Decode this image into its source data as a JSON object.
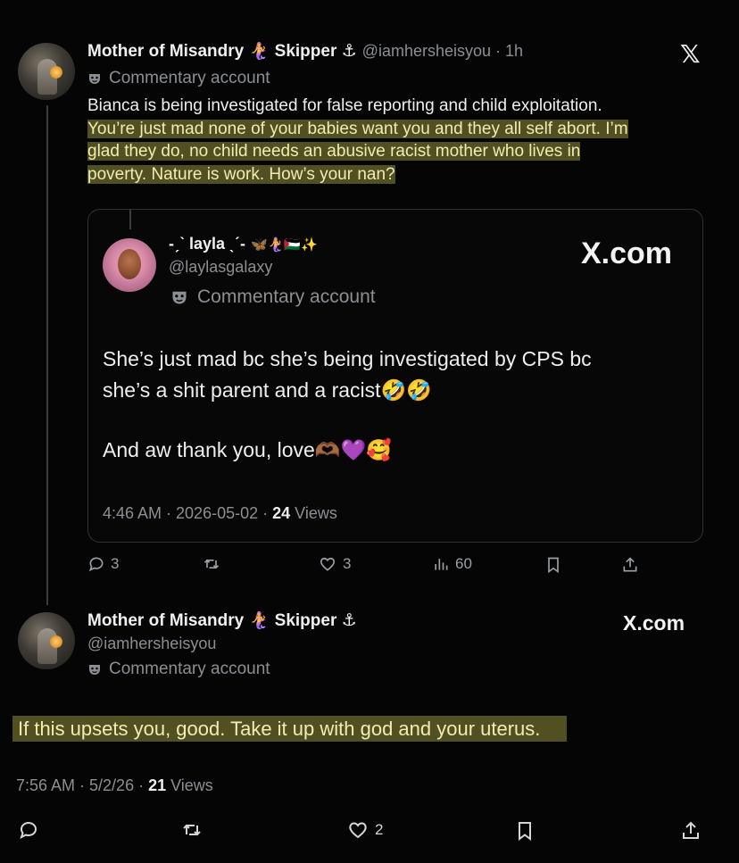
{
  "tweet1": {
    "display_name": "Mother of Misandry",
    "name_emoji": "🧜‍♀️",
    "name_suffix": "Skipper ⚓",
    "handle_time": "@iamhersheisyou · 1h",
    "label": "Commentary account",
    "close_glyph": "𝕏",
    "text_plain": "Bianca is being investigated for false reporting and child exploitation.",
    "text_highlight_lines": [
      "You’re just mad none of your babies want you and they all self abort. I’m",
      "glad they do, no child needs an abusive racist mother who lives in",
      "poverty. Nature is work. How’s your nan?"
    ],
    "actions": {
      "replies": "3",
      "likes": "3",
      "views": "60"
    }
  },
  "quote": {
    "display_name": "-ˏˋ layla ˎˊ-",
    "name_emojis": "🦋🧜‍♀️🇵🇸✨",
    "handle": "@laylasgalaxy",
    "label": "Commentary account",
    "brand": "X.com",
    "line1": "She’s just mad bc she’s being investigated by CPS bc",
    "line2": "she’s a shit parent and a racist🤣🤣",
    "line3": "And aw thank you, love🫶🏾💜🥰",
    "meta_time": "4:46 AM · 2026-05-02 · ",
    "meta_views_count": "24",
    "meta_views_label": " Views"
  },
  "tweet2": {
    "display_name": "Mother of Misandry",
    "name_emoji": "🧜‍♀️",
    "name_suffix": "Skipper ⚓",
    "handle": "@iamhersheisyou",
    "label": "Commentary account",
    "brand": "X.com",
    "text": "If this upsets you, good. Take it up with god and your uterus.",
    "meta_time": "7:56 AM · 5/2/26 · ",
    "meta_views_count": "21",
    "meta_views_label": " Views",
    "likes": "2"
  },
  "icons": {
    "label_icon": "commentary-mask-icon",
    "reply": "reply-icon",
    "retweet": "retweet-icon",
    "like": "heart-icon",
    "views": "views-bar-icon",
    "bookmark": "bookmark-icon",
    "share": "share-icon"
  },
  "colors": {
    "background": "#050505",
    "highlight": "#e4e25a",
    "text": "#e7e9ea",
    "muted": "#8b8f94"
  }
}
